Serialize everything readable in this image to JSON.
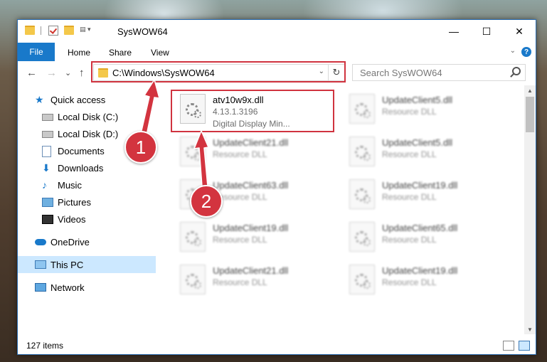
{
  "window": {
    "title": "SysWOW64",
    "minimize": "—",
    "maximize": "☐",
    "close": "✕"
  },
  "ribbon": {
    "tabs": [
      "File",
      "Home",
      "Share",
      "View"
    ],
    "help": "?",
    "collapse": "⌄"
  },
  "nav": {
    "back": "←",
    "forward": "→",
    "recent": "⌄",
    "up": "↑",
    "address": "C:\\Windows\\SysWOW64",
    "address_drop": "⌄",
    "refresh": "↻",
    "search_placeholder": "Search SysWOW64"
  },
  "sidebar": {
    "items": [
      {
        "label": "Quick access",
        "icon": "star-icon",
        "pinned": false
      },
      {
        "label": "Local Disk (C:)",
        "icon": "drive-icon",
        "pinned": true
      },
      {
        "label": "Local Disk (D:)",
        "icon": "drive-icon",
        "pinned": true
      },
      {
        "label": "Documents",
        "icon": "documents-icon",
        "pinned": true
      },
      {
        "label": "Downloads",
        "icon": "downloads-icon",
        "pinned": true
      },
      {
        "label": "Music",
        "icon": "music-icon",
        "pinned": true
      },
      {
        "label": "Pictures",
        "icon": "pictures-icon",
        "pinned": true
      },
      {
        "label": "Videos",
        "icon": "videos-icon",
        "pinned": true
      },
      {
        "label": "OneDrive",
        "icon": "onedrive-icon",
        "pinned": false
      },
      {
        "label": "This PC",
        "icon": "this-pc-icon",
        "pinned": false,
        "selected": true
      },
      {
        "label": "Network",
        "icon": "network-icon",
        "pinned": false
      }
    ],
    "pin_glyph": "📌"
  },
  "files": {
    "highlighted": {
      "name": "atv10w9x.dll",
      "version": "4.13.1.3196",
      "description": "Digital Display Min..."
    },
    "column1": [
      {
        "name": "UpdateClient21.dll",
        "type": "Resource DLL"
      },
      {
        "name": "UpdateClient63.dll",
        "type": "Resource DLL"
      },
      {
        "name": "UpdateClient19.dll",
        "type": "Resource DLL"
      },
      {
        "name": "UpdateClient21.dll",
        "type": "Resource DLL"
      }
    ],
    "column2": [
      {
        "name": "UpdateClient5.dll",
        "type": "Resource DLL"
      },
      {
        "name": "UpdateClient5.dll",
        "type": "Resource DLL"
      },
      {
        "name": "UpdateClient19.dll",
        "type": "Resource DLL"
      },
      {
        "name": "UpdateClient65.dll",
        "type": "Resource DLL"
      },
      {
        "name": "UpdateClient19.dll",
        "type": "Resource DLL"
      }
    ]
  },
  "status": {
    "count": "127 items"
  },
  "callouts": {
    "one": "1",
    "two": "2"
  },
  "colors": {
    "accent": "#1979ca",
    "highlight": "#d0333f",
    "selected": "#cce8ff"
  }
}
